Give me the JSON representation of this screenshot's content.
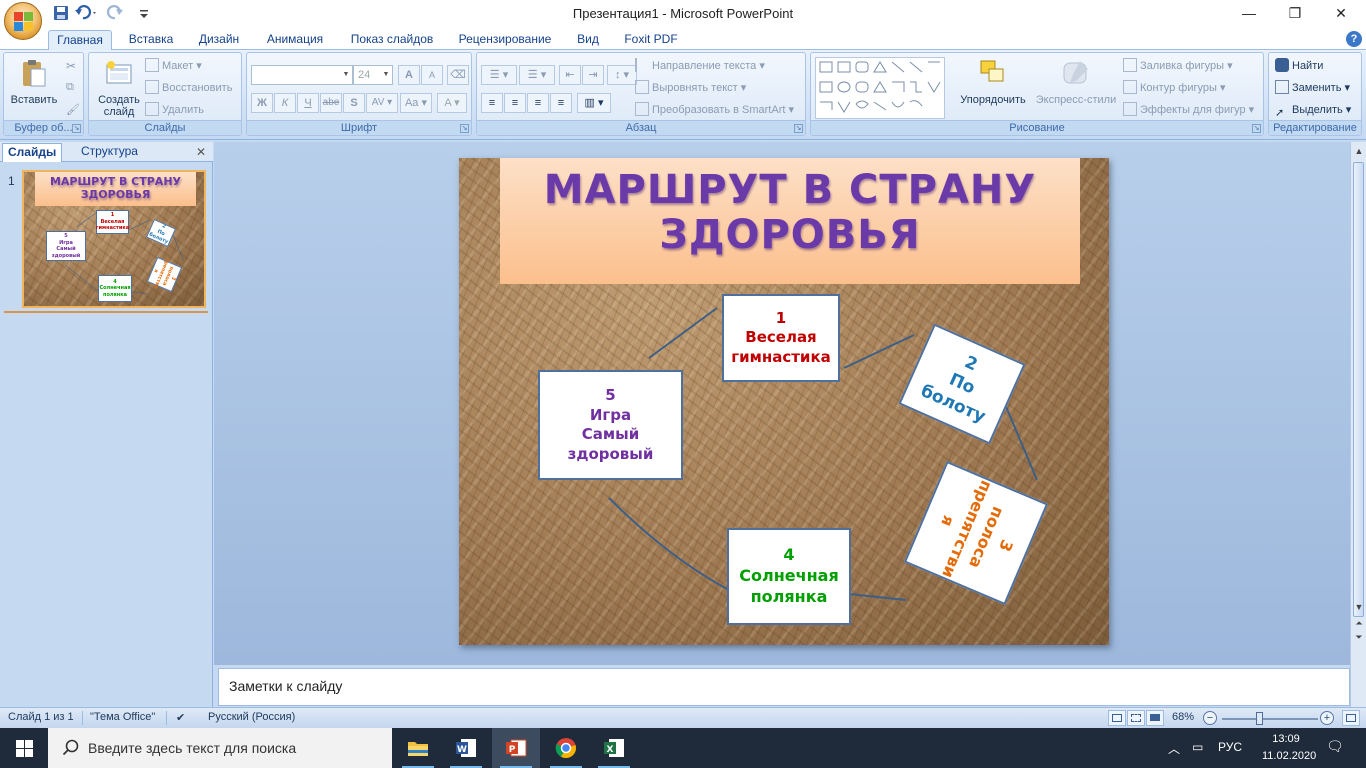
{
  "window": {
    "title": "Презентация1 - Microsoft PowerPoint",
    "minimize_icon": "minimize-icon",
    "maximize_icon": "restore-icon",
    "close_icon": "close-icon"
  },
  "qat": {
    "icons": [
      "save-icon",
      "undo-icon",
      "redo-icon",
      "customize-icon"
    ]
  },
  "tabs": [
    {
      "label": "Главная",
      "active": true
    },
    {
      "label": "Вставка"
    },
    {
      "label": "Дизайн"
    },
    {
      "label": "Анимация"
    },
    {
      "label": "Показ слайдов"
    },
    {
      "label": "Рецензирование"
    },
    {
      "label": "Вид"
    },
    {
      "label": "Foxit PDF"
    }
  ],
  "ribbon": {
    "clipboard": {
      "paste": "Вставить",
      "label": "Буфер об..."
    },
    "slides": {
      "create_line1": "Создать",
      "create_line2": "слайд",
      "layout": "Макет",
      "reset": "Восстановить",
      "delete": "Удалить",
      "label": "Слайды"
    },
    "font": {
      "size": "24",
      "bold": "Ж",
      "italic": "К",
      "underline": "Ч",
      "strike": "abe",
      "shadow": "S",
      "spacing": "AV",
      "case": "Aa",
      "grow": "A",
      "shrink": "A",
      "label": "Шрифт"
    },
    "paragraph": {
      "direction": "Направление текста",
      "align": "Выровнять текст",
      "smartart": "Преобразовать в SmartArt",
      "label": "Абзац"
    },
    "drawing": {
      "arrange": "Упорядочить",
      "quick_styles": "Экспресс-стили",
      "fill": "Заливка фигуры",
      "outline": "Контур фигуры",
      "effects": "Эффекты для фигур",
      "label": "Рисование"
    },
    "editing": {
      "find": "Найти",
      "replace": "Заменить",
      "select": "Выделить",
      "label": "Редактирование"
    }
  },
  "left_pane": {
    "tab_slides": "Слайды",
    "tab_outline": "Структура",
    "slide_number": "1"
  },
  "slide": {
    "title_line1": "МАРШРУТ В СТРАНУ",
    "title_line2": "ЗДОРОВЬЯ",
    "cards": [
      {
        "lines": [
          "1",
          "Веселая",
          "гимнастика"
        ],
        "color": "#c00000"
      },
      {
        "lines": [
          "2",
          "По",
          "болоту"
        ],
        "color": "#1f78b4"
      },
      {
        "lines": [
          "3",
          "полоса",
          "препятстви",
          "я"
        ],
        "color": "#e36c09"
      },
      {
        "lines": [
          "4",
          "Солнечная",
          "полянка"
        ],
        "color": "#00a000"
      },
      {
        "lines": [
          "5",
          "Игра",
          "Самый",
          "здоровый"
        ],
        "color": "#7030a0"
      }
    ]
  },
  "notes": {
    "placeholder": "Заметки к слайду"
  },
  "status": {
    "slide_info": "Слайд 1 из 1",
    "theme": "\"Тема Office\"",
    "language": "Русский (Россия)",
    "zoom": "68%",
    "zoom_level": 0.4
  },
  "taskbar": {
    "search_placeholder": "Введите здесь текст для поиска",
    "apps": [
      "file-explorer-icon",
      "word-icon",
      "powerpoint-icon",
      "chrome-icon",
      "excel-icon"
    ],
    "lang": "РУС",
    "time": "13:09",
    "date": "11.02.2020"
  },
  "colors": {
    "title_purple": "#6a3aa8",
    "card_border": "#4f6f9c",
    "ribbon_blue": "#c5d9f1"
  }
}
